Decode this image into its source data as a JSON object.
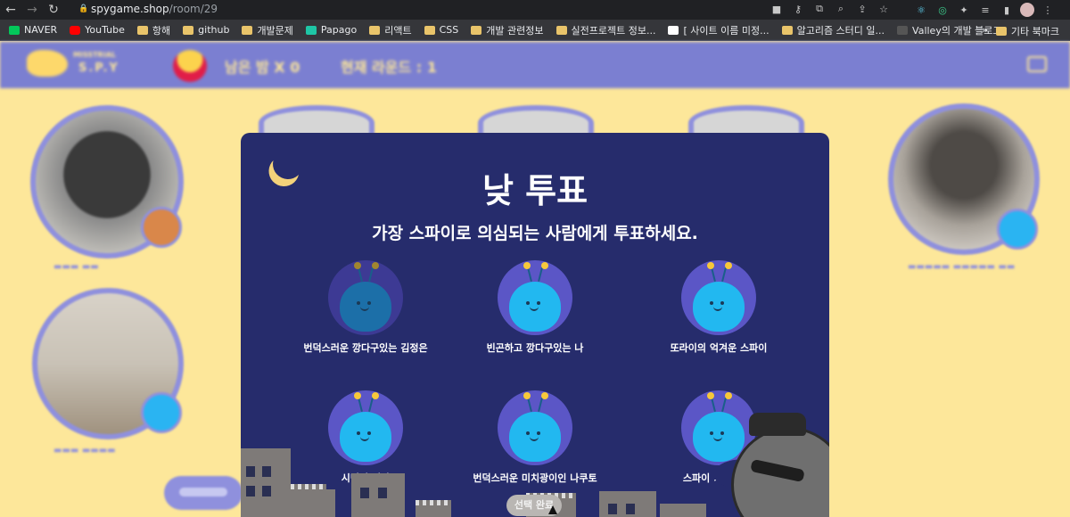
{
  "browser": {
    "url_host": "spygame.shop",
    "url_path": "/room/29",
    "bookmarks": [
      {
        "label": "NAVER",
        "icon": "naver-icon"
      },
      {
        "label": "YouTube",
        "icon": "youtube-icon"
      },
      {
        "label": "항해",
        "icon": "folder-icon"
      },
      {
        "label": "github",
        "icon": "folder-icon"
      },
      {
        "label": "개발문제",
        "icon": "folder-icon"
      },
      {
        "label": "Papago",
        "icon": "papago-icon"
      },
      {
        "label": "리액트",
        "icon": "folder-icon"
      },
      {
        "label": "CSS",
        "icon": "folder-icon"
      },
      {
        "label": "개발 관련정보",
        "icon": "folder-icon"
      },
      {
        "label": "실전프로젝트 정보...",
        "icon": "folder-icon"
      },
      {
        "label": "[ 사이트 이름 미정...",
        "icon": "notion-icon"
      },
      {
        "label": "알고리즘 스터디 일...",
        "icon": "folder-icon"
      },
      {
        "label": "Valley의 개발 블로그",
        "icon": "valley-icon"
      }
    ],
    "bookmarks_more": "»",
    "other_bookmarks": "기타 북마크"
  },
  "game_header": {
    "logo_line1": "MISSTRIAL",
    "logo_line2": "S.P.Y",
    "time_text": "남은 밤 X 0",
    "round_text": "현재 라운드 : 1"
  },
  "modal": {
    "title": "낮 투표",
    "subtitle": "가장 스파이로 의심되는 사람에게 투표하세요.",
    "candidates": [
      {
        "name": "번덕스러운 깡다구있는 김정은",
        "state": "dimmed"
      },
      {
        "name": "빈곤하고 깡다구있는 나",
        "state": "normal"
      },
      {
        "name": "또라이의 억겨운 스파이",
        "state": "normal"
      },
      {
        "name": "시민의 전파",
        "state": "normal"
      },
      {
        "name": "번덕스러운 미치광이인 나쿠토",
        "state": "normal"
      },
      {
        "name": "스파이 >>>>>",
        "state": "normal"
      }
    ],
    "confirm_label": "선택 완료"
  },
  "colors": {
    "page_bg": "#fde79a",
    "header_bg": "#7b7fd1",
    "modal_bg": "#262c6c",
    "alien": "#22b8f0",
    "avatar_ring": "#5b56c6",
    "accent_yellow": "#f7c83a"
  }
}
